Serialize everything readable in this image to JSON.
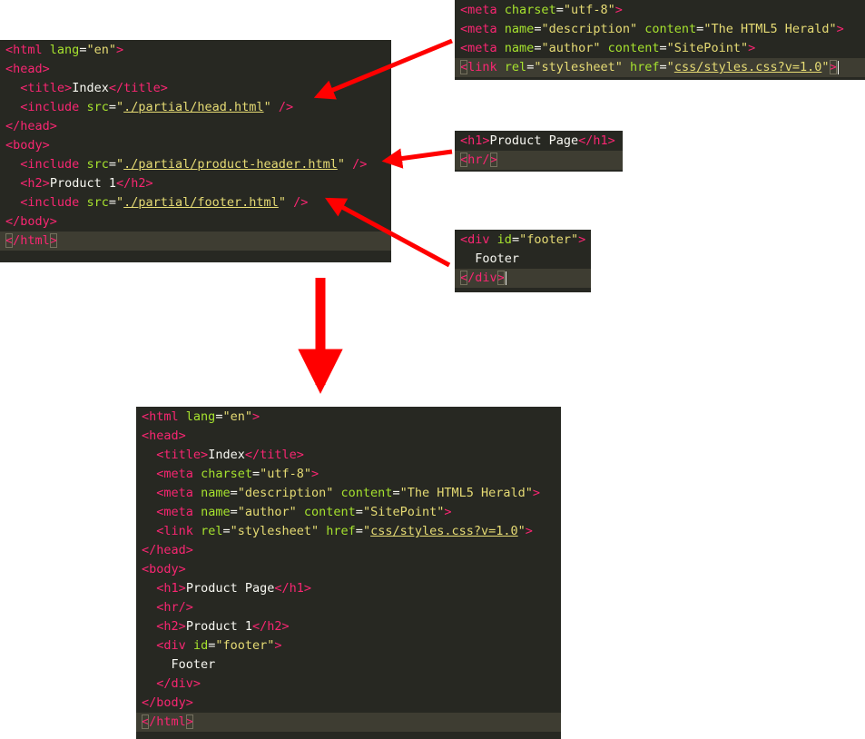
{
  "template_panel": {
    "lines": [
      [
        [
          "t",
          "<"
        ],
        [
          "t",
          "html"
        ],
        [
          "p",
          " "
        ],
        [
          "a",
          "lang"
        ],
        [
          "p",
          "="
        ],
        [
          "s",
          "\"en\""
        ],
        [
          "t",
          ">"
        ]
      ],
      [
        [
          "t",
          "<"
        ],
        [
          "t",
          "head"
        ],
        [
          "t",
          ">"
        ]
      ],
      [
        [
          "p",
          "  "
        ],
        [
          "t",
          "<"
        ],
        [
          "t",
          "title"
        ],
        [
          "t",
          ">"
        ],
        [
          "p",
          "Index"
        ],
        [
          "t",
          "</"
        ],
        [
          "t",
          "title"
        ],
        [
          "t",
          ">"
        ]
      ],
      [
        [
          "p",
          "  "
        ],
        [
          "t",
          "<"
        ],
        [
          "t",
          "include"
        ],
        [
          "p",
          " "
        ],
        [
          "a",
          "src"
        ],
        [
          "p",
          "="
        ],
        [
          "s",
          "\""
        ],
        [
          "u",
          "./partial/head.html"
        ],
        [
          "s",
          "\""
        ],
        [
          "p",
          " "
        ],
        [
          "t",
          "/>"
        ]
      ],
      [
        [
          "t",
          "</"
        ],
        [
          "t",
          "head"
        ],
        [
          "t",
          ">"
        ]
      ],
      [
        [
          "t",
          "<"
        ],
        [
          "t",
          "body"
        ],
        [
          "t",
          ">"
        ]
      ],
      [
        [
          "p",
          "  "
        ],
        [
          "t",
          "<"
        ],
        [
          "t",
          "include"
        ],
        [
          "p",
          " "
        ],
        [
          "a",
          "src"
        ],
        [
          "p",
          "="
        ],
        [
          "s",
          "\""
        ],
        [
          "u",
          "./partial/product-header.html"
        ],
        [
          "s",
          "\""
        ],
        [
          "p",
          " "
        ],
        [
          "t",
          "/>"
        ]
      ],
      [
        [
          "p",
          "  "
        ],
        [
          "t",
          "<"
        ],
        [
          "t",
          "h2"
        ],
        [
          "t",
          ">"
        ],
        [
          "p",
          "Product 1"
        ],
        [
          "t",
          "</"
        ],
        [
          "t",
          "h2"
        ],
        [
          "t",
          ">"
        ]
      ],
      [
        [
          "p",
          "  "
        ],
        [
          "t",
          "<"
        ],
        [
          "t",
          "include"
        ],
        [
          "p",
          " "
        ],
        [
          "a",
          "src"
        ],
        [
          "p",
          "="
        ],
        [
          "s",
          "\""
        ],
        [
          "u",
          "./partial/footer.html"
        ],
        [
          "s",
          "\""
        ],
        [
          "p",
          " "
        ],
        [
          "t",
          "/>"
        ]
      ],
      [
        [
          "t",
          "</"
        ],
        [
          "t",
          "body"
        ],
        [
          "t",
          ">"
        ]
      ],
      [
        [
          "b",
          "<"
        ],
        [
          "t",
          "/"
        ],
        [
          "t",
          "html"
        ],
        [
          "b",
          ">"
        ]
      ]
    ],
    "highlight_line": 10
  },
  "head_partial": {
    "lines": [
      [
        [
          "t",
          "<"
        ],
        [
          "t",
          "meta"
        ],
        [
          "p",
          " "
        ],
        [
          "a",
          "charset"
        ],
        [
          "p",
          "="
        ],
        [
          "s",
          "\"utf-8\""
        ],
        [
          "t",
          ">"
        ]
      ],
      [
        [
          "t",
          "<"
        ],
        [
          "t",
          "meta"
        ],
        [
          "p",
          " "
        ],
        [
          "a",
          "name"
        ],
        [
          "p",
          "="
        ],
        [
          "s",
          "\"description\""
        ],
        [
          "p",
          " "
        ],
        [
          "a",
          "content"
        ],
        [
          "p",
          "="
        ],
        [
          "s",
          "\"The HTML5 Herald\""
        ],
        [
          "t",
          ">"
        ]
      ],
      [
        [
          "t",
          "<"
        ],
        [
          "t",
          "meta"
        ],
        [
          "p",
          " "
        ],
        [
          "a",
          "name"
        ],
        [
          "p",
          "="
        ],
        [
          "s",
          "\"author\""
        ],
        [
          "p",
          " "
        ],
        [
          "a",
          "content"
        ],
        [
          "p",
          "="
        ],
        [
          "s",
          "\"SitePoint\""
        ],
        [
          "t",
          ">"
        ]
      ],
      [
        [
          "b",
          "<"
        ],
        [
          "t",
          "link"
        ],
        [
          "p",
          " "
        ],
        [
          "a",
          "rel"
        ],
        [
          "p",
          "="
        ],
        [
          "s",
          "\"stylesheet\""
        ],
        [
          "p",
          " "
        ],
        [
          "a",
          "href"
        ],
        [
          "p",
          "="
        ],
        [
          "s",
          "\""
        ],
        [
          "u",
          "css/styles.css?v=1.0"
        ],
        [
          "s",
          "\""
        ],
        [
          "b",
          ">"
        ],
        [
          "c",
          ""
        ]
      ]
    ],
    "highlight_line": 3
  },
  "product_header_partial": {
    "lines": [
      [
        [
          "t",
          "<"
        ],
        [
          "t",
          "h1"
        ],
        [
          "t",
          ">"
        ],
        [
          "p",
          "Product Page"
        ],
        [
          "t",
          "</"
        ],
        [
          "t",
          "h1"
        ],
        [
          "t",
          ">"
        ]
      ],
      [
        [
          "b",
          "<"
        ],
        [
          "t",
          "hr"
        ],
        [
          "t",
          "/"
        ],
        [
          "b",
          ">"
        ]
      ]
    ],
    "highlight_line": 1
  },
  "footer_partial": {
    "lines": [
      [
        [
          "t",
          "<"
        ],
        [
          "t",
          "div"
        ],
        [
          "p",
          " "
        ],
        [
          "a",
          "id"
        ],
        [
          "p",
          "="
        ],
        [
          "s",
          "\"footer\""
        ],
        [
          "t",
          ">"
        ]
      ],
      [
        [
          "p",
          "  Footer"
        ]
      ],
      [
        [
          "b",
          "<"
        ],
        [
          "t",
          "/"
        ],
        [
          "t",
          "div"
        ],
        [
          "b",
          ">"
        ],
        [
          "c",
          ""
        ]
      ]
    ],
    "highlight_line": 2
  },
  "result_panel": {
    "lines": [
      [
        [
          "t",
          "<"
        ],
        [
          "t",
          "html"
        ],
        [
          "p",
          " "
        ],
        [
          "a",
          "lang"
        ],
        [
          "p",
          "="
        ],
        [
          "s",
          "\"en\""
        ],
        [
          "t",
          ">"
        ]
      ],
      [
        [
          "t",
          "<"
        ],
        [
          "t",
          "head"
        ],
        [
          "t",
          ">"
        ]
      ],
      [
        [
          "p",
          "  "
        ],
        [
          "t",
          "<"
        ],
        [
          "t",
          "title"
        ],
        [
          "t",
          ">"
        ],
        [
          "p",
          "Index"
        ],
        [
          "t",
          "</"
        ],
        [
          "t",
          "title"
        ],
        [
          "t",
          ">"
        ]
      ],
      [
        [
          "p",
          "  "
        ],
        [
          "t",
          "<"
        ],
        [
          "t",
          "meta"
        ],
        [
          "p",
          " "
        ],
        [
          "a",
          "charset"
        ],
        [
          "p",
          "="
        ],
        [
          "s",
          "\"utf-8\""
        ],
        [
          "t",
          ">"
        ]
      ],
      [
        [
          "p",
          "  "
        ],
        [
          "t",
          "<"
        ],
        [
          "t",
          "meta"
        ],
        [
          "p",
          " "
        ],
        [
          "a",
          "name"
        ],
        [
          "p",
          "="
        ],
        [
          "s",
          "\"description\""
        ],
        [
          "p",
          " "
        ],
        [
          "a",
          "content"
        ],
        [
          "p",
          "="
        ],
        [
          "s",
          "\"The HTML5 Herald\""
        ],
        [
          "t",
          ">"
        ]
      ],
      [
        [
          "p",
          "  "
        ],
        [
          "t",
          "<"
        ],
        [
          "t",
          "meta"
        ],
        [
          "p",
          " "
        ],
        [
          "a",
          "name"
        ],
        [
          "p",
          "="
        ],
        [
          "s",
          "\"author\""
        ],
        [
          "p",
          " "
        ],
        [
          "a",
          "content"
        ],
        [
          "p",
          "="
        ],
        [
          "s",
          "\"SitePoint\""
        ],
        [
          "t",
          ">"
        ]
      ],
      [
        [
          "p",
          "  "
        ],
        [
          "t",
          "<"
        ],
        [
          "t",
          "link"
        ],
        [
          "p",
          " "
        ],
        [
          "a",
          "rel"
        ],
        [
          "p",
          "="
        ],
        [
          "s",
          "\"stylesheet\""
        ],
        [
          "p",
          " "
        ],
        [
          "a",
          "href"
        ],
        [
          "p",
          "="
        ],
        [
          "s",
          "\""
        ],
        [
          "u",
          "css/styles.css?v=1.0"
        ],
        [
          "s",
          "\""
        ],
        [
          "t",
          ">"
        ]
      ],
      [
        [
          "t",
          "</"
        ],
        [
          "t",
          "head"
        ],
        [
          "t",
          ">"
        ]
      ],
      [
        [
          "t",
          "<"
        ],
        [
          "t",
          "body"
        ],
        [
          "t",
          ">"
        ]
      ],
      [
        [
          "p",
          "  "
        ],
        [
          "t",
          "<"
        ],
        [
          "t",
          "h1"
        ],
        [
          "t",
          ">"
        ],
        [
          "p",
          "Product Page"
        ],
        [
          "t",
          "</"
        ],
        [
          "t",
          "h1"
        ],
        [
          "t",
          ">"
        ]
      ],
      [
        [
          "p",
          "  "
        ],
        [
          "t",
          "<"
        ],
        [
          "t",
          "hr"
        ],
        [
          "t",
          "/>"
        ]
      ],
      [
        [
          "p",
          "  "
        ],
        [
          "t",
          "<"
        ],
        [
          "t",
          "h2"
        ],
        [
          "t",
          ">"
        ],
        [
          "p",
          "Product 1"
        ],
        [
          "t",
          "</"
        ],
        [
          "t",
          "h2"
        ],
        [
          "t",
          ">"
        ]
      ],
      [
        [
          "p",
          "  "
        ],
        [
          "t",
          "<"
        ],
        [
          "t",
          "div"
        ],
        [
          "p",
          " "
        ],
        [
          "a",
          "id"
        ],
        [
          "p",
          "="
        ],
        [
          "s",
          "\"footer\""
        ],
        [
          "t",
          ">"
        ]
      ],
      [
        [
          "p",
          "    Footer"
        ]
      ],
      [
        [
          "p",
          "  "
        ],
        [
          "t",
          "</"
        ],
        [
          "t",
          "div"
        ],
        [
          "t",
          ">"
        ]
      ],
      [
        [
          "t",
          "</"
        ],
        [
          "t",
          "body"
        ],
        [
          "t",
          ">"
        ]
      ],
      [
        [
          "b",
          "<"
        ],
        [
          "t",
          "/"
        ],
        [
          "t",
          "html"
        ],
        [
          "b",
          ">"
        ]
      ]
    ],
    "highlight_line": 16
  },
  "colors": {
    "editor_bg": "#272822",
    "line_highlight": "#3e3d32",
    "tag": "#f92672",
    "attribute": "#a6e22e",
    "string": "#e6db74",
    "text": "#f8f8f2",
    "arrow": "#ff0000"
  }
}
